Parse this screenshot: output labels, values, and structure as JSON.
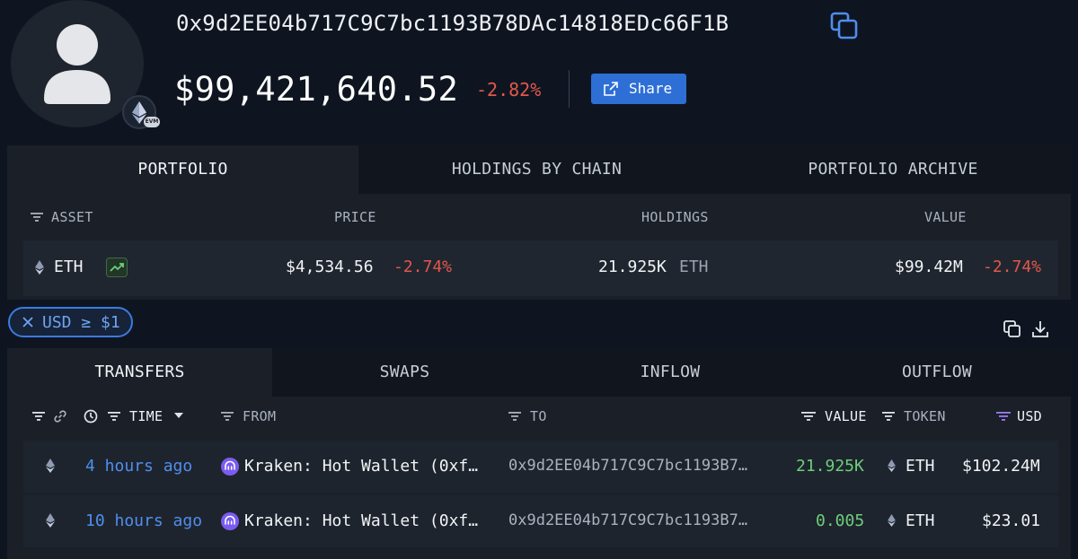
{
  "profile": {
    "address": "0x9d2EE04b717C9C7bc1193B78DAc14818EDc66F1B",
    "balance": "$99,421,640.52",
    "balance_change": "-2.82%",
    "share_label": "Share",
    "chain_badge": "EVM"
  },
  "portfolio_tabs": [
    "PORTFOLIO",
    "HOLDINGS BY CHAIN",
    "PORTFOLIO ARCHIVE"
  ],
  "portfolio_columns": {
    "asset": "ASSET",
    "price": "PRICE",
    "holdings": "HOLDINGS",
    "value": "VALUE"
  },
  "portfolio_rows": [
    {
      "asset": "ETH",
      "price": "$4,534.56",
      "price_change": "-2.74%",
      "holdings_amount": "21.925K",
      "holdings_token": "ETH",
      "value": "$99.42M",
      "value_change": "-2.74%"
    }
  ],
  "filter_chip": "USD ≥ $1",
  "transfer_tabs": [
    "TRANSFERS",
    "SWAPS",
    "INFLOW",
    "OUTFLOW"
  ],
  "transfer_columns": {
    "time": "TIME",
    "from": "FROM",
    "to": "TO",
    "value": "VALUE",
    "token": "TOKEN",
    "usd": "USD"
  },
  "transfers": [
    {
      "time": "4 hours ago",
      "from": "Kraken: Hot Wallet (0xf…",
      "to": "0x9d2EE04b717C9C7bc1193B7…",
      "value": "21.925K",
      "token": "ETH",
      "usd": "$102.24M"
    },
    {
      "time": "10 hours ago",
      "from": "Kraken: Hot Wallet (0xf…",
      "to": "0x9d2EE04b717C9C7bc1193B7…",
      "value": "0.005",
      "token": "ETH",
      "usd": "$23.01"
    }
  ],
  "colors": {
    "negative": "#e2574c",
    "positive": "#6ccf7a",
    "link": "#4f8ef0",
    "accent": "#2e6fd6",
    "usd_filter": "#9b7cf0"
  },
  "icons": [
    "user-icon",
    "ethereum-icon",
    "copy-icon",
    "external-link-icon",
    "filter-icon",
    "trending-up-icon",
    "close-icon",
    "link-icon",
    "clock-icon",
    "caret-down-icon",
    "download-icon",
    "kraken-icon"
  ]
}
